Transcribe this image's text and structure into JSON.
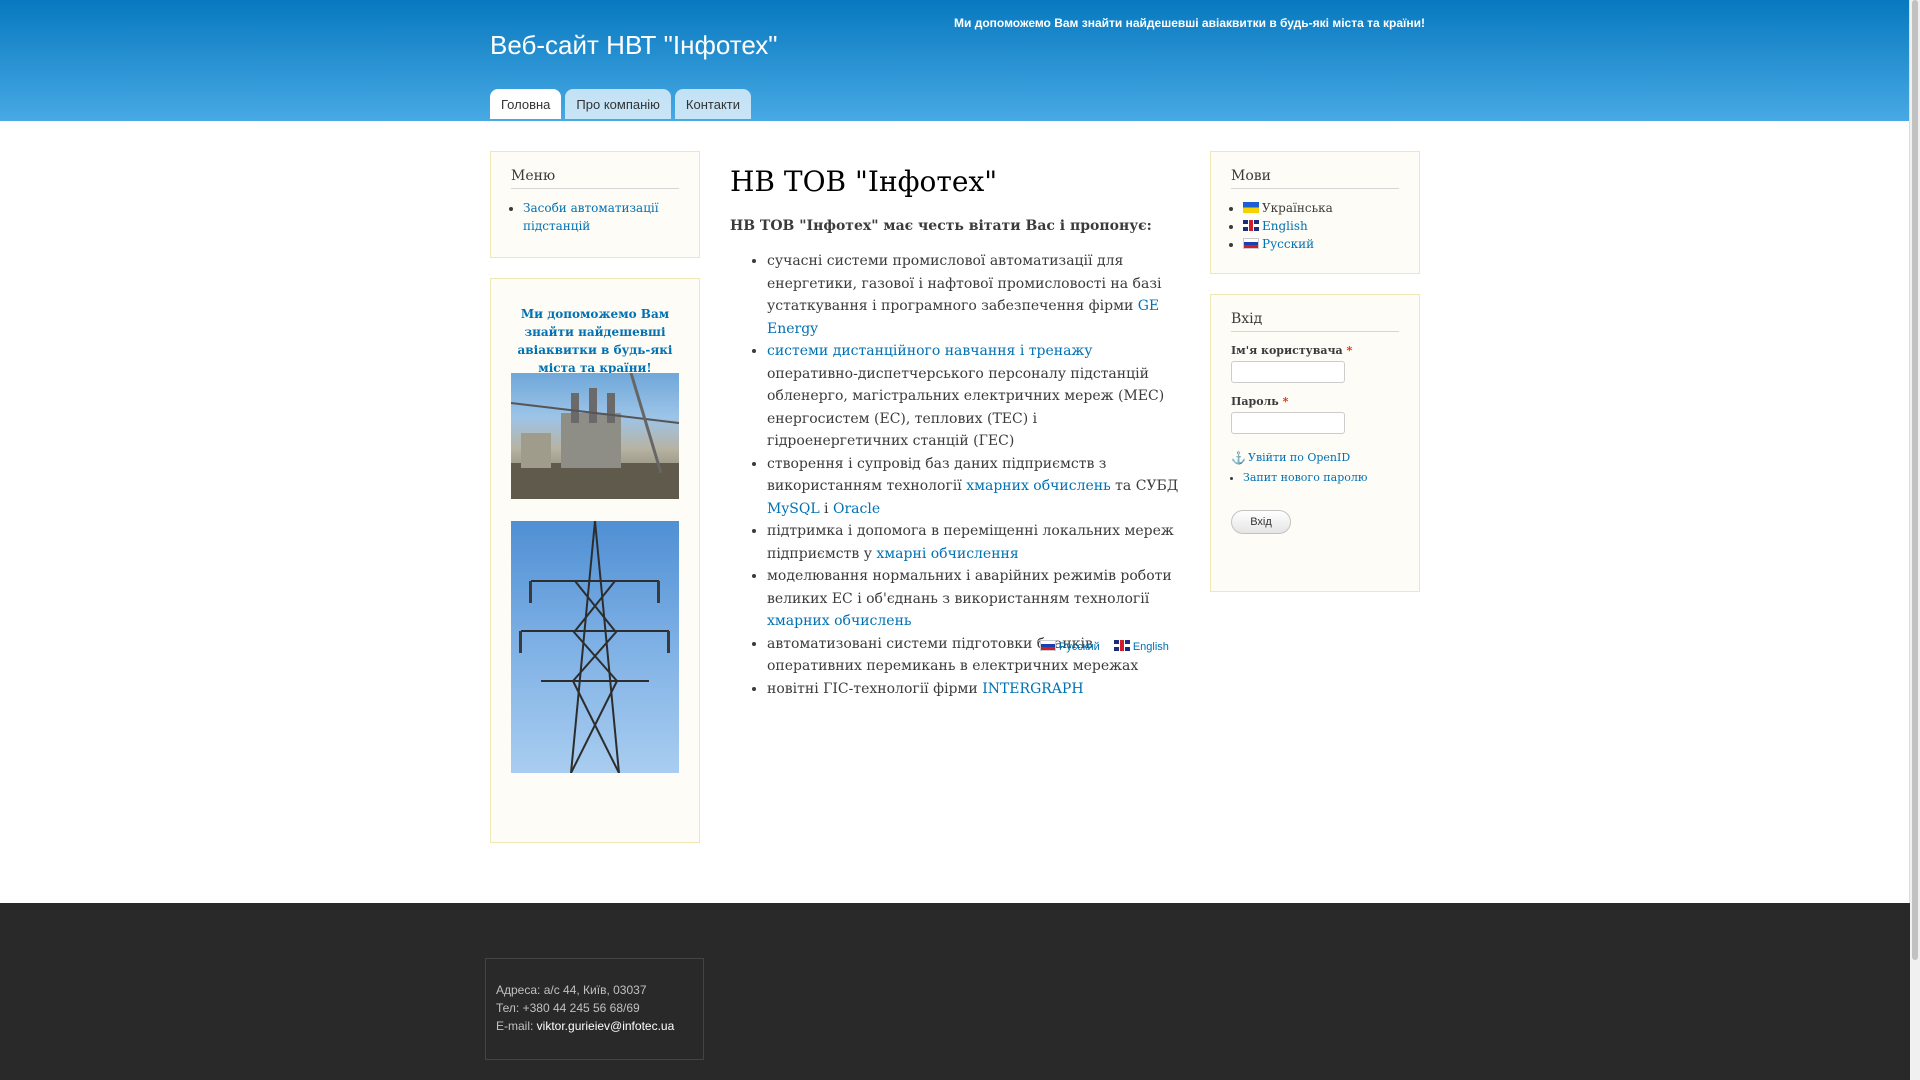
{
  "header": {
    "site_name": "Веб-сайт НВТ \"Інфотех\"",
    "slogan": "Ми допоможемо Вам знайти найдешевші авіаквитки в будь-які міста та країни!",
    "tabs": [
      {
        "label": "Головна",
        "active": true
      },
      {
        "label": "Про компанію",
        "active": false
      },
      {
        "label": "Контакти",
        "active": false
      }
    ]
  },
  "sidebar_left": {
    "menu_title": "Меню",
    "menu_items": [
      "Засоби автоматизації підстанцій"
    ],
    "ad_text": "Ми допоможемо Вам знайти найдешевші авіаквитки в будь-які міста та країни!"
  },
  "main": {
    "title": "НВ ТОВ \"Інфотех\"",
    "intro": "НВ ТОВ \"Інфотех\" має честь вітати Вас і пропонує:",
    "items": [
      {
        "before": "сучасні системи промислової автоматизації для енергетики, газової і нафтової промисловості на базі устаткування і програмного забезпечення фірми ",
        "link1": "GE Energy",
        "mid": "",
        "link2": "",
        "mid2": "",
        "link3": "",
        "after": ""
      },
      {
        "before": "",
        "link1": "системи дистанційного навчання і тренажу",
        "mid": " оперативно-диспетчерського персоналу підстанцій обленерго, магістральних електричних мереж (МЕС) енергосистем (ЕС), теплових (ТЕС) і гідроенергетичних станцій (ГЕС)",
        "link2": "",
        "mid2": "",
        "link3": "",
        "after": ""
      },
      {
        "before": "створення і супровід баз даних підприємств з використанням технології ",
        "link1": "хмарних обчислень",
        "mid": " та СУБД ",
        "link2": "MySQL",
        "mid2": " і ",
        "link3": "Oracle",
        "after": ""
      },
      {
        "before": "підтримка і допомога в переміщенні локальних мереж підприємств у ",
        "link1": "хмарні обчислення",
        "mid": "",
        "link2": "",
        "mid2": "",
        "link3": "",
        "after": ""
      },
      {
        "before": "моделювання нормальних і аварійних режимів роботи великих ЕС і об'єднань з використанням технології ",
        "link1": "хмарних обчислень",
        "mid": "",
        "link2": "",
        "mid2": "",
        "link3": "",
        "after": ""
      },
      {
        "before": "автоматизовані системи підготовки бланків оперативних перемикань в електричних мережах",
        "link1": "",
        "mid": "",
        "link2": "",
        "mid2": "",
        "link3": "",
        "after": ""
      },
      {
        "before": "новітні ГІС-технології фірми ",
        "link1": "INTERGRAPH",
        "mid": "",
        "link2": "",
        "mid2": "",
        "link3": "",
        "after": ""
      }
    ],
    "translations": [
      {
        "label": "Русский",
        "flag": "flag-ru"
      },
      {
        "label": "English",
        "flag": "flag-en"
      }
    ]
  },
  "sidebar_right": {
    "langs_title": "Мови",
    "languages": [
      {
        "label": "Українська",
        "flag": "flag-ua",
        "active": true
      },
      {
        "label": "English",
        "flag": "flag-en",
        "active": false
      },
      {
        "label": "Русский",
        "flag": "flag-ru",
        "active": false
      }
    ],
    "login_title": "Вхід",
    "username_label": "Ім'я користувача",
    "password_label": "Пароль",
    "required_mark": "*",
    "openid_link": "Увійти по OpenID",
    "new_password_link": "Запит нового паролю",
    "login_button": "Вхід"
  },
  "footer": {
    "address": "Адреса: а/с 44, Київ, 03037",
    "phone": "Тел: +380 44 245 56 68/69",
    "email_label": "E-mail: ",
    "email": "viktor.gurieiev@infotec.ua"
  },
  "colors": {
    "header_top": "#0779bf",
    "header_bottom": "#48a9e4",
    "link": "#0071b3",
    "footer_bg": "#292929",
    "block_bg": "#fdfcf6",
    "block_border": "#f0e8b4"
  }
}
